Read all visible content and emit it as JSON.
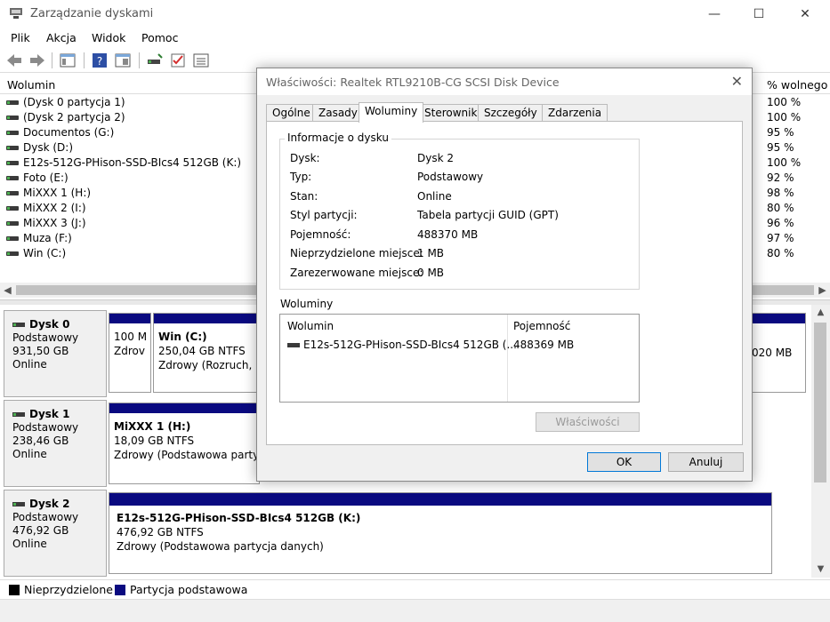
{
  "window": {
    "title": "Zarządzanie dyskami",
    "minimize": "—",
    "maximize": "☐",
    "close": "✕"
  },
  "menu": [
    "Plik",
    "Akcja",
    "Widok",
    "Pomoc"
  ],
  "volume_list": {
    "col_volume": "Wolumin",
    "col_free_pct": "% wolnego",
    "rows": [
      {
        "name": "(Dysk 0 partycja 1)",
        "free": "100 %"
      },
      {
        "name": "(Dysk 2 partycja 2)",
        "free": "100 %"
      },
      {
        "name": "Documentos (G:)",
        "free": "95 %"
      },
      {
        "name": "Dysk (D:)",
        "free": "95 %"
      },
      {
        "name": "E12s-512G-PHison-SSD-BIcs4 512GB (K:)",
        "free": "100 %"
      },
      {
        "name": "Foto (E:)",
        "free": "92 %"
      },
      {
        "name": "MiXXX 1 (H:)",
        "free": "98 %"
      },
      {
        "name": "MiXXX 2 (I:)",
        "free": "80 %"
      },
      {
        "name": "MiXXX 3 (J:)",
        "free": "96 %"
      },
      {
        "name": "Muza (F:)",
        "free": "97 %"
      },
      {
        "name": "Win (C:)",
        "free": "80 %"
      }
    ]
  },
  "disks": [
    {
      "name": "Dysk 0",
      "type": "Podstawowy",
      "size": "931,50 GB",
      "status": "Online",
      "partitions": [
        {
          "name": "",
          "line1": "100 M",
          "line2": "Zdrov"
        },
        {
          "name": "Win  (C:)",
          "line1": "250,04 GB NTFS",
          "line2": "Zdrowy (Rozruch,"
        },
        {
          "name": "",
          "line1": "020 MB",
          "line2": ""
        }
      ]
    },
    {
      "name": "Dysk 1",
      "type": "Podstawowy",
      "size": "238,46 GB",
      "status": "Online",
      "partitions": [
        {
          "name": "MiXXX 1  (H:)",
          "line1": "18,09 GB NTFS",
          "line2": "Zdrowy (Podstawowa party"
        }
      ]
    },
    {
      "name": "Dysk 2",
      "type": "Podstawowy",
      "size": "476,92 GB",
      "status": "Online",
      "partitions": [
        {
          "name": "E12s-512G-PHison-SSD-BIcs4 512GB  (K:)",
          "line1": "476,92 GB NTFS",
          "line2": "Zdrowy (Podstawowa partycja danych)"
        }
      ]
    }
  ],
  "legend": [
    {
      "label": "Nieprzydzielone",
      "color": "#000000"
    },
    {
      "label": "Partycja podstawowa",
      "color": "#0a0a80"
    }
  ],
  "dialog": {
    "title": "Właściwości: Realtek RTL9210B-CG SCSI Disk Device",
    "close": "✕",
    "tabs": [
      "Ogólne",
      "Zasady",
      "Woluminy",
      "Sterownik",
      "Szczegóły",
      "Zdarzenia"
    ],
    "active_tab": "Woluminy",
    "disk_info": {
      "group_label": "Informacje o dysku",
      "rows": [
        {
          "label": "Dysk:",
          "value": "Dysk 2"
        },
        {
          "label": "Typ:",
          "value": "Podstawowy"
        },
        {
          "label": "Stan:",
          "value": "Online"
        },
        {
          "label": "Styl partycji:",
          "value": "Tabela partycji GUID (GPT)"
        },
        {
          "label": "Pojemność:",
          "value": "488370 MB"
        },
        {
          "label": "Nieprzydzielone miejsce:",
          "value": "1 MB"
        },
        {
          "label": "Zarezerwowane miejsce:",
          "value": "0 MB"
        }
      ]
    },
    "volumes": {
      "group_label": "Woluminy",
      "col_volume": "Wolumin",
      "col_capacity": "Pojemność",
      "rows": [
        {
          "name": "E12s-512G-PHison-SSD-BIcs4 512GB (...",
          "capacity": "488369 MB"
        }
      ]
    },
    "properties_button": "Właściwości",
    "ok_button": "OK",
    "cancel_button": "Anuluj"
  }
}
